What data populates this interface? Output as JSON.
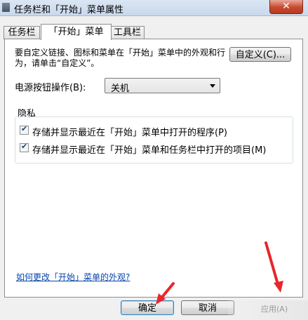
{
  "window": {
    "title": "任务栏和「开始」菜单属性",
    "close_label": "✕"
  },
  "tabs": [
    {
      "label": "任务栏"
    },
    {
      "label": "「开始」菜单"
    },
    {
      "label": "工具栏"
    }
  ],
  "start_menu": {
    "description": "要自定义链接、图标和菜单在「开始」菜单中的外观和行为，请单击“自定义”。",
    "customize_button": "自定义(C)...",
    "power_label": "电源按钮操作(B):",
    "power_value": "关机"
  },
  "privacy": {
    "group_label": "隐私",
    "options": [
      {
        "label": "存储并显示最近在「开始」菜单中打开的程序(P)",
        "checked": true
      },
      {
        "label": "存储并显示最近在「开始」菜单和任务栏中打开的项目(M)",
        "checked": true
      }
    ]
  },
  "help_link": "如何更改「开始」菜单的外观?",
  "footer": {
    "ok": "确定",
    "cancel": "取消",
    "apply_partial": "应用(A)"
  },
  "annotation_color": "#e8262b"
}
